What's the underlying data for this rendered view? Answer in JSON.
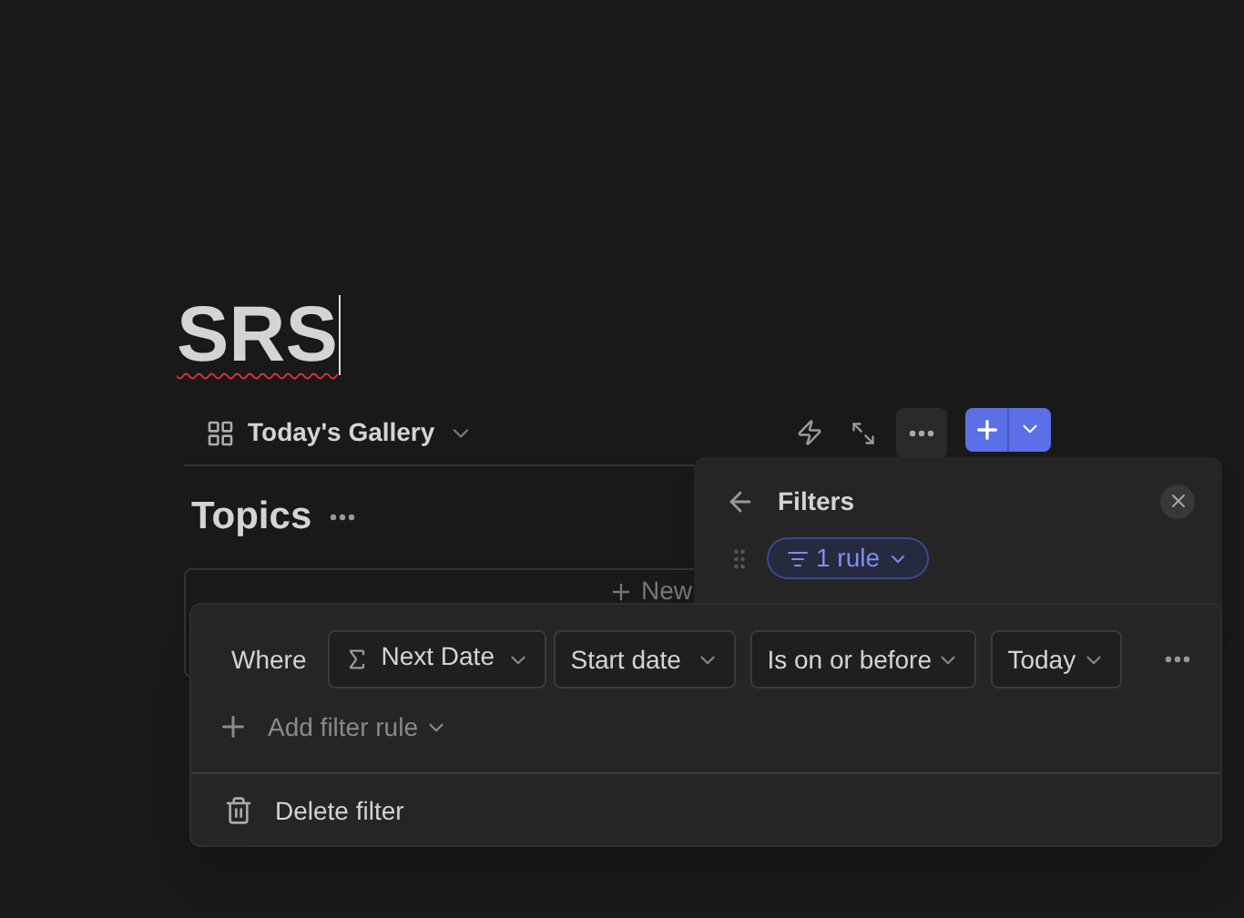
{
  "page": {
    "title": "SRS",
    "spellcheck_error": true
  },
  "view_bar": {
    "view_name": "Today's Gallery",
    "new_button_primary": true
  },
  "section": {
    "title": "Topics",
    "new_label": "New"
  },
  "filters_panel": {
    "title": "Filters",
    "rule_chip": "1 rule"
  },
  "rule_popup": {
    "where_label": "Where",
    "conditions": [
      {
        "kind": "property",
        "label": "Next Date"
      },
      {
        "kind": "select",
        "label": "Start date"
      },
      {
        "kind": "select",
        "label": "Is on or before"
      },
      {
        "kind": "select",
        "label": "Today"
      }
    ],
    "add_rule": "Add filter rule",
    "delete": "Delete filter"
  }
}
